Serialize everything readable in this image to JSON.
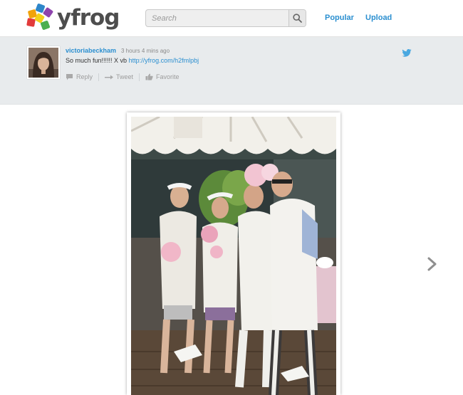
{
  "header": {
    "logo_text": "yfrog",
    "search_placeholder": "Search",
    "nav": {
      "popular": "Popular",
      "upload": "Upload"
    }
  },
  "tweet": {
    "username": "victoriabeckham",
    "time_ago": "3 hours 4 mins ago",
    "text": "So much fun!!!!!! X vb",
    "link": "http://yfrog.com/h2fmlpbj",
    "actions": {
      "reply": "Reply",
      "retweet": "Tweet",
      "favorite": "Favorite"
    }
  },
  "colors": {
    "accent": "#2b8fd0",
    "tweet_bar_bg": "#e8ebed",
    "logo_squares": [
      "#e74c3c",
      "#f39c12",
      "#2980b9",
      "#8e44ad",
      "#27ae60",
      "#f1c40f"
    ]
  },
  "icons": {
    "search": "magnifier-icon",
    "reply": "speech-bubble-icon",
    "retweet": "retweet-arrow-icon",
    "favorite": "thumbs-up-icon",
    "twitter": "twitter-bird-icon",
    "next": "chevron-right-icon"
  }
}
